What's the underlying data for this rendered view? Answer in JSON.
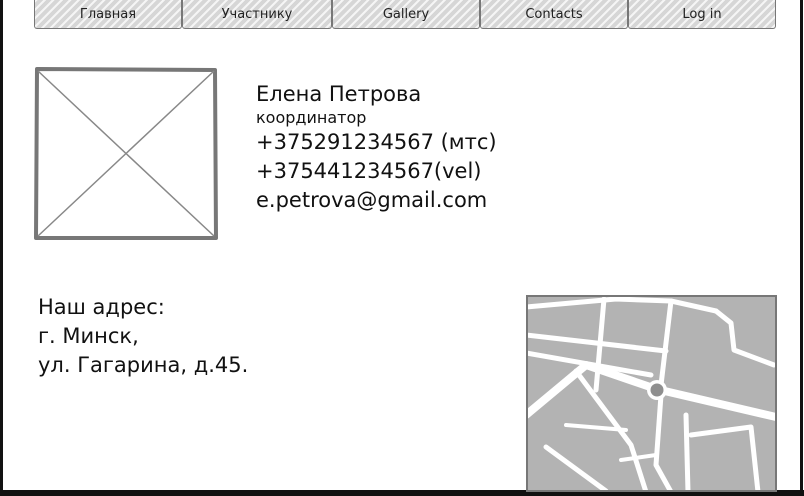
{
  "nav": {
    "items": [
      {
        "label": "Главная"
      },
      {
        "label": "Участнику"
      },
      {
        "label": "Gallery"
      },
      {
        "label": "Contacts"
      },
      {
        "label": "Log in"
      }
    ]
  },
  "contact": {
    "name": "Елена Петрова",
    "role": "координатор",
    "phone_mts": "+375291234567 (мтс)",
    "phone_vel": "+375441234567(vel)",
    "email": "e.petrova@gmail.com"
  },
  "address": {
    "heading": "Наш адрес:",
    "city": "г. Минск,",
    "street": "ул. Гагарина, д.45."
  },
  "colors": {
    "nav_fill": "#d6d6d6",
    "map_blocks": "#b3b3b3",
    "map_roads": "#ffffff",
    "border": "#777777"
  },
  "icons": {
    "photo": "image-placeholder-icon",
    "map": "map-icon"
  }
}
